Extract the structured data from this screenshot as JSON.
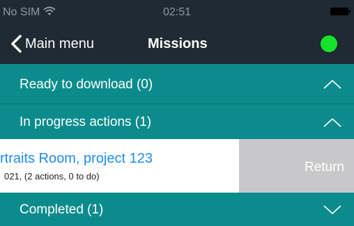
{
  "status_bar": {
    "carrier": "No SIM",
    "time": "02:51"
  },
  "nav": {
    "back_label": "Main menu",
    "title": "Missions",
    "status_color": "#16e22a"
  },
  "sections": {
    "ready": {
      "label": "Ready to download (0)",
      "expanded": true
    },
    "in_progress": {
      "label": "In progress actions (1)",
      "expanded": true
    },
    "completed": {
      "label": "Completed (1)",
      "expanded": false
    }
  },
  "mission": {
    "title": "rtraits Room, project 123",
    "subtitle": "021, (2 actions, 0 to do)",
    "swipe_action": "Return"
  },
  "colors": {
    "nav_background": "#1f2a33",
    "section_background": "#0b8b8b",
    "link_blue": "#1d8cf0",
    "swipe_action_background": "#c8c8ca"
  }
}
